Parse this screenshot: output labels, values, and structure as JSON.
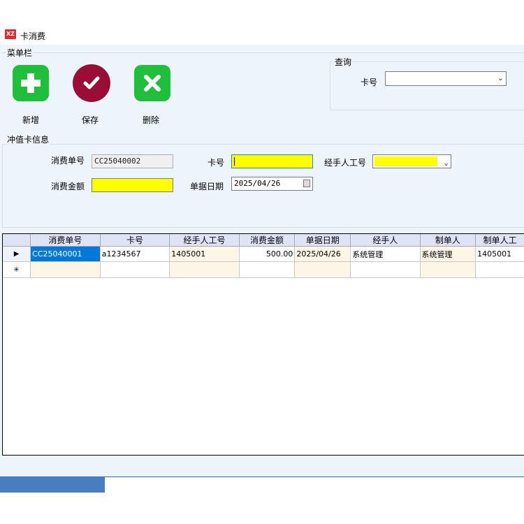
{
  "window": {
    "title": "卡消费",
    "icon_text": "XZ"
  },
  "menu": {
    "group_label": "菜单栏",
    "buttons": [
      {
        "label": "新增",
        "icon": "plus-icon",
        "color": "#1fbf3b"
      },
      {
        "label": "保存",
        "icon": "check-icon",
        "color": "#9a0d37"
      },
      {
        "label": "删除",
        "icon": "x-icon",
        "color": "#1fbf3b"
      }
    ]
  },
  "query": {
    "group_label": "查询",
    "card_label": "卡号",
    "card_value": ""
  },
  "info": {
    "group_label": "冲值卡信息",
    "order_label": "消费单号",
    "order_value": "CC25040002",
    "card_label": "卡号",
    "card_value": "",
    "employee_label": "经手人工号",
    "employee_value": "",
    "amount_label": "消费金额",
    "amount_value": "",
    "date_label": "单据日期",
    "date_value": "2025/04/26"
  },
  "grid": {
    "columns": [
      "消费单号",
      "卡号",
      "经手人工号",
      "消费金额",
      "单据日期",
      "经手人",
      "制单人",
      "制单人工"
    ],
    "rows": [
      [
        "CC25040001",
        "a1234567",
        "1405001",
        "500.00",
        "2025/04/26",
        "系统管理",
        "系统管理",
        "1405001"
      ]
    ],
    "current_row_marker": "▶",
    "new_row_marker": "✳"
  },
  "status": {
    "progress": 0.2
  },
  "colors": {
    "field_highlight": "#ffff00",
    "selection": "#0078d7",
    "background": "#eef4fc"
  }
}
